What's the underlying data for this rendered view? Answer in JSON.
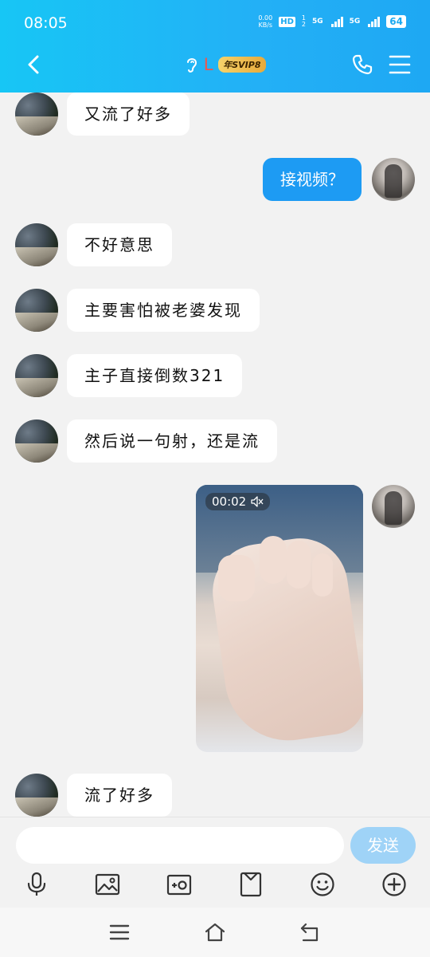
{
  "status_bar": {
    "time": "08:05",
    "net_speed_value": "0.00",
    "net_speed_unit": "KB/s",
    "hd": "HD",
    "sim1": "1",
    "sim2": "2",
    "sig1_label": "5G",
    "sig2_label": "5G",
    "battery": "64"
  },
  "header": {
    "title": "L",
    "vip_badge": "年SVIP8",
    "icons": [
      "back-icon",
      "ear-icon",
      "phone-icon",
      "menu-icon"
    ],
    "color": "#1ab4f5"
  },
  "messages": [
    {
      "side": "in",
      "text": "又流了好多"
    },
    {
      "side": "out",
      "text": "接视频？"
    },
    {
      "side": "in",
      "text": "不好意思"
    },
    {
      "side": "in",
      "text": "主要害怕被老婆发现"
    },
    {
      "side": "in",
      "text": "主子直接倒数321"
    },
    {
      "side": "in",
      "text": "然后说一句射，还是流"
    },
    {
      "side": "out",
      "type": "video",
      "duration": "00:02",
      "muted": true
    },
    {
      "side": "in",
      "text": "流了好多"
    }
  ],
  "composer": {
    "input_value": "",
    "send_label": "发送",
    "send_color": "#9fd3f7",
    "tools": [
      "microphone-icon",
      "image-icon",
      "camera-icon",
      "folder-icon",
      "emoji-icon",
      "plus-icon"
    ]
  },
  "navbar": {
    "icons": [
      "recent-apps-icon",
      "home-icon",
      "back-nav-icon"
    ]
  }
}
